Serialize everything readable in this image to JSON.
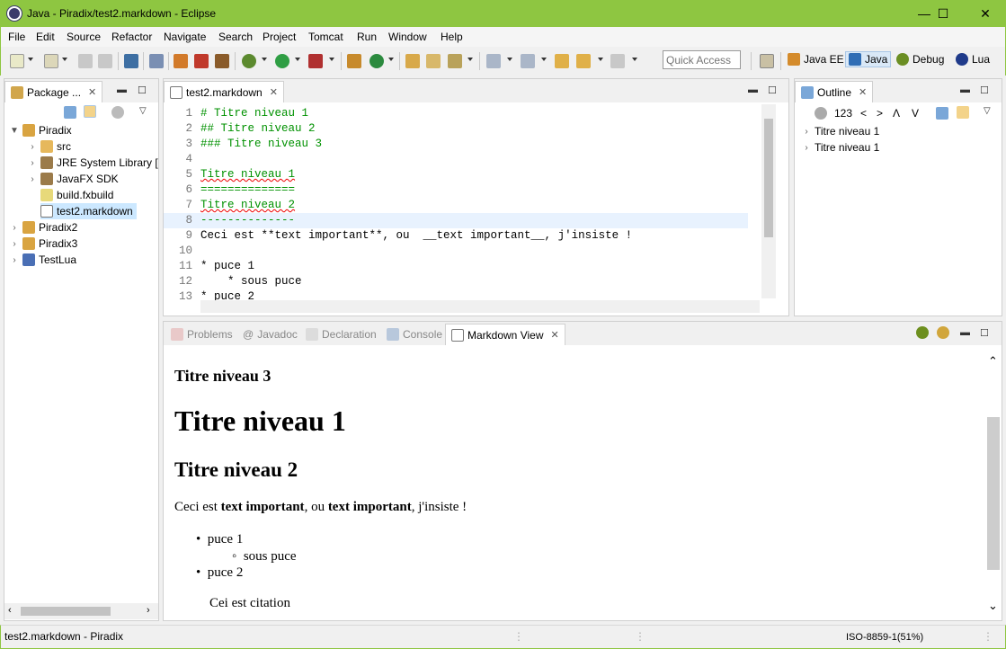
{
  "window": {
    "title": "Java - Piradix/test2.markdown - Eclipse",
    "min": "—",
    "max": "☐",
    "close": "✕",
    "accent": "#8ec641"
  },
  "menu": [
    "File",
    "Edit",
    "Source",
    "Refactor",
    "Navigate",
    "Search",
    "Project",
    "Tomcat",
    "Run",
    "Window",
    "Help"
  ],
  "toolbar": {
    "quick_access_placeholder": "Quick Access",
    "perspectives": [
      "Java EE",
      "Java",
      "Debug",
      "Lua"
    ]
  },
  "package_explorer": {
    "tab_label": "Package ...",
    "tree": [
      {
        "label": "Piradix",
        "expanded": true,
        "level": 0,
        "icon": "project-folder-icon"
      },
      {
        "label": "src",
        "level": 1,
        "icon": "source-folder-icon"
      },
      {
        "label": "JRE System Library [",
        "level": 1,
        "icon": "library-icon"
      },
      {
        "label": "JavaFX SDK",
        "level": 1,
        "icon": "library-icon"
      },
      {
        "label": "build.fxbuild",
        "level": 1,
        "icon": "file-icon"
      },
      {
        "label": "test2.markdown",
        "level": 1,
        "icon": "markdown-file-icon",
        "selected": true
      },
      {
        "label": "Piradix2",
        "level": 0,
        "icon": "project-folder-icon"
      },
      {
        "label": "Piradix3",
        "level": 0,
        "icon": "project-folder-icon"
      },
      {
        "label": "TestLua",
        "level": 0,
        "icon": "lua-project-icon"
      }
    ]
  },
  "editor": {
    "tab_label": "test2.markdown",
    "lines": [
      {
        "n": "1",
        "text": "# Titre niveau 1"
      },
      {
        "n": "2",
        "text": "## Titre niveau 2"
      },
      {
        "n": "3",
        "text": "### Titre niveau 3"
      },
      {
        "n": "4",
        "text": ""
      },
      {
        "n": "5",
        "text": "Titre niveau 1"
      },
      {
        "n": "6",
        "text": "=============="
      },
      {
        "n": "7",
        "text": "Titre niveau 2"
      },
      {
        "n": "8",
        "text": "--------------"
      },
      {
        "n": "9",
        "text": "Ceci est **text important**, ou  __text important__, j'insiste !"
      },
      {
        "n": "10",
        "text": ""
      },
      {
        "n": "11",
        "text": "* puce 1"
      },
      {
        "n": "12",
        "text": "    * sous puce"
      },
      {
        "n": "13",
        "text": "* puce 2"
      }
    ]
  },
  "outline": {
    "tab_label": "Outline",
    "toolbar": [
      "123",
      "<",
      ">",
      "Λ",
      "V"
    ],
    "items": [
      "Titre niveau 1",
      "Titre niveau 1"
    ]
  },
  "bottom_tabs": [
    "Problems",
    "Javadoc",
    "Declaration",
    "Console",
    "Markdown View"
  ],
  "markdown_view": {
    "h3": "Titre niveau 3",
    "h1": "Titre niveau 1",
    "h2": "Titre niveau 2",
    "para_1": "Ceci est ",
    "para_bold_1": "text important",
    "para_2": ", ou ",
    "para_bold_2": "text important",
    "para_3": ", j'insiste !",
    "bullets": [
      "puce 1",
      "sous puce",
      "puce 2"
    ],
    "quote": "Cei est citation"
  },
  "status": {
    "left": "test2.markdown - Piradix",
    "encoding": "ISO-8859-1(51%)"
  }
}
